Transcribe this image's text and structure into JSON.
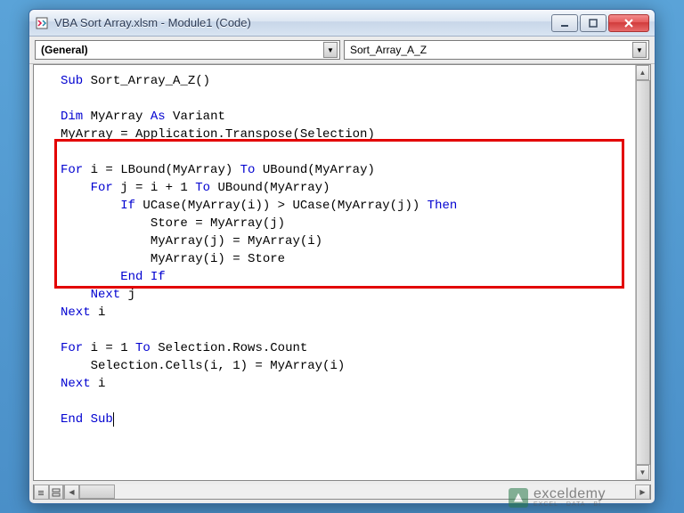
{
  "window": {
    "title": "VBA Sort Array.xlsm - Module1 (Code)"
  },
  "dropdowns": {
    "left": "(General)",
    "right": "Sort_Array_A_Z"
  },
  "code": {
    "l1a": "Sub",
    "l1b": " Sort_Array_A_Z()",
    "l3a": "Dim",
    "l3b": " MyArray ",
    "l3c": "As",
    "l3d": " Variant",
    "l4": "MyArray = Application.Transpose(Selection)",
    "l6a": "For",
    "l6b": " i = LBound(MyArray) ",
    "l6c": "To",
    "l6d": " UBound(MyArray)",
    "l7a": "    For",
    "l7b": " j = i + 1 ",
    "l7c": "To",
    "l7d": " UBound(MyArray)",
    "l8a": "        If",
    "l8b": " UCase(MyArray(i)) > UCase(MyArray(j)) ",
    "l8c": "Then",
    "l9": "            Store = MyArray(j)",
    "l10": "            MyArray(j) = MyArray(i)",
    "l11": "            MyArray(i) = Store",
    "l12": "        End If",
    "l13a": "    Next",
    "l13b": " j",
    "l14a": "Next",
    "l14b": " i",
    "l16a": "For",
    "l16b": " i = 1 ",
    "l16c": "To",
    "l16d": " Selection.Rows.Count",
    "l17": "    Selection.Cells(i, 1) = MyArray(i)",
    "l18a": "Next",
    "l18b": " i",
    "l20": "End Sub"
  },
  "watermark": {
    "name": "exceldemy",
    "tagline": "EXCEL · DATA · BI"
  }
}
